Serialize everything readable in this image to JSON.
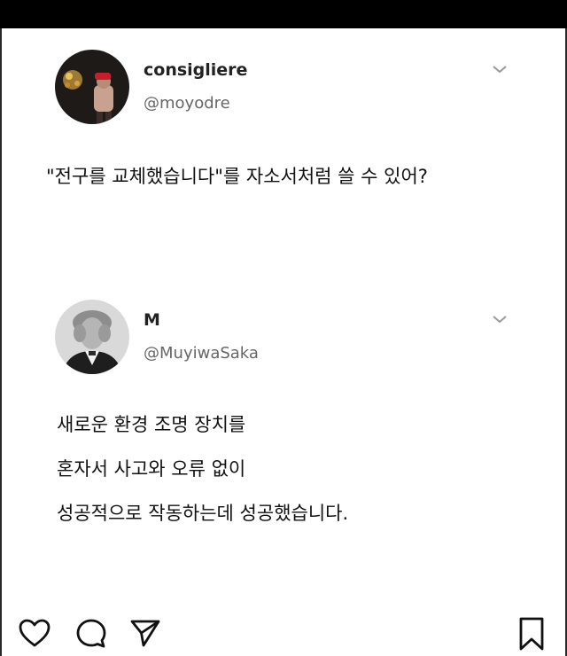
{
  "tweets": [
    {
      "username": "consigliere",
      "handle": "@moyodre",
      "lines": [
        "\"전구를 교체했습니다\"를 자소서처럼 쓸 수 있어?"
      ]
    },
    {
      "username": "M",
      "handle": "@MuyiwaSaka",
      "lines": [
        "새로운 환경 조명 장치를",
        "혼자서 사고와 오류 없이",
        "성공적으로 작동하는데 성공했습니다."
      ]
    }
  ],
  "icons": {
    "like": "heart-icon",
    "comment": "comment-icon",
    "share": "send-icon",
    "save": "bookmark-icon",
    "more": "chevron-down-icon"
  }
}
